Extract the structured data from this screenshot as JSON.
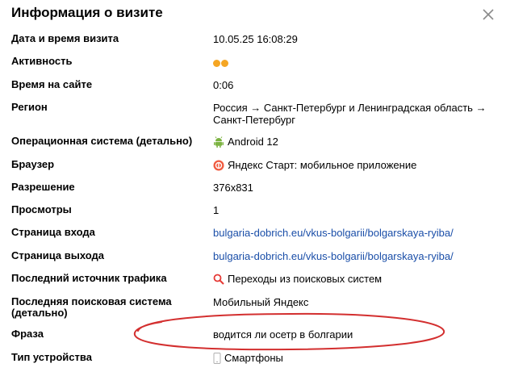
{
  "dialog": {
    "title": "Информация о визите",
    "close_icon": "close-icon"
  },
  "rows": [
    {
      "label": "Дата и время визита",
      "value": "10.05.25 16:08:29"
    },
    {
      "label": "Активность",
      "value_icon": "activity-dots-icon",
      "dot_color": "#f5a623"
    },
    {
      "label": "Время на сайте",
      "value": "0:06"
    },
    {
      "label": "Регион",
      "value_line1": "Россия → Санкт-Петербург и Ленинградская область →",
      "value_line2": "Санкт-Петербург"
    },
    {
      "label": "Операционная система (детально)",
      "value": "Android 12",
      "icon": "android-icon",
      "icon_color": "#7cb342"
    },
    {
      "label": "Браузер",
      "value": "Яндекс Старт: мобильное приложение",
      "icon": "yandex-start-icon",
      "icon_color": "#f05a3f"
    },
    {
      "label": "Разрешение",
      "value": "376x831"
    },
    {
      "label": "Просмотры",
      "value": "1"
    },
    {
      "label": "Страница входа",
      "value": "bulgaria-dobrich.eu/vkus-bolgarii/bolgarskaya-ryiba/"
    },
    {
      "label": "Страница выхода",
      "value": "bulgaria-dobrich.eu/vkus-bolgarii/bolgarskaya-ryiba/"
    },
    {
      "label": "Последний источник трафика",
      "value": "Переходы из поисковых систем",
      "icon": "search-icon",
      "icon_color": "#e53935"
    },
    {
      "label_line1": "Последняя поисковая система",
      "label_line2": "(детально)",
      "value": "Мобильный Яндекс"
    },
    {
      "label": "Фраза",
      "value": "водится ли осетр в болгарии"
    },
    {
      "label": "Тип устройства",
      "value": "Смартфоны",
      "icon": "smartphone-icon"
    }
  ],
  "colors": {
    "link": "#1a4ea8",
    "annotation": "#d32f2f"
  }
}
